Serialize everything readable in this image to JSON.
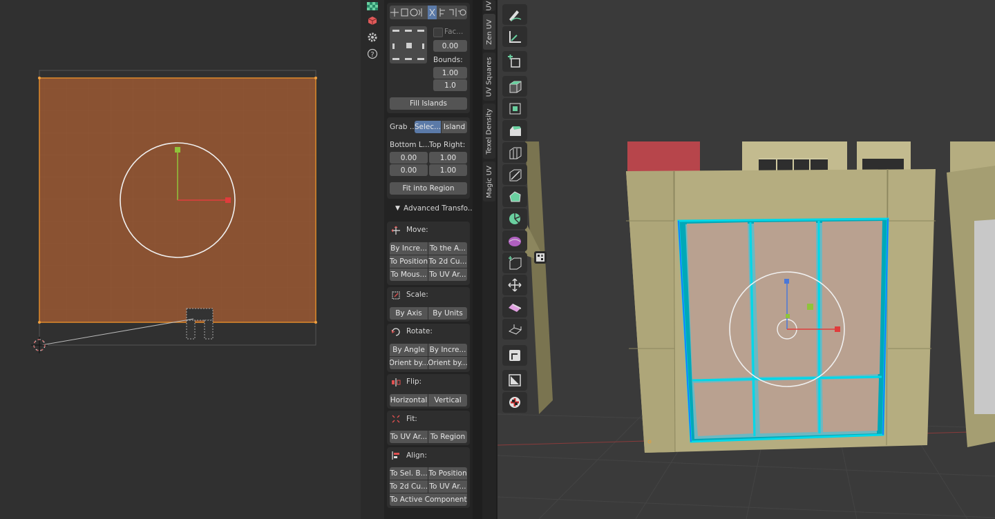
{
  "tabs": [
    {
      "label": "UV"
    },
    {
      "label": "Zen UV"
    },
    {
      "label": "UV Squares"
    },
    {
      "label": "Texel Density"
    },
    {
      "label": "Magic UV"
    }
  ],
  "fill": {
    "face_checkbox_label": "Fac...",
    "offset_value": "0.00",
    "bounds_label": "Bounds:",
    "bounds_x": "1.00",
    "bounds_y": "1.0",
    "fill_islands_button": "Fill Islands"
  },
  "region": {
    "grab_label": "Grab ...",
    "selected_button": "Selec...",
    "island_button": "Island",
    "bottom_left_label": "Bottom L...",
    "top_right_label": "Top Right:",
    "bl_x": "0.00",
    "bl_y": "0.00",
    "tr_x": "1.00",
    "tr_y": "1.00",
    "fit_button": "Fit into Region"
  },
  "advanced": {
    "header": "Advanced Transfo...",
    "move_label": "Move:",
    "move_buttons": [
      "By Incre...",
      "To the A...",
      "To Position",
      "To 2d Cu...",
      "To Mous...",
      "To UV Ar..."
    ],
    "scale_label": "Scale:",
    "scale_buttons": [
      "By Axis",
      "By Units"
    ],
    "rotate_label": "Rotate:",
    "rotate_buttons": [
      "By Angle",
      "By Incre...",
      "Orient by...",
      "Orient by..."
    ],
    "flip_label": "Flip:",
    "flip_buttons": [
      "Horizontal",
      "Vertical"
    ],
    "fit_label": "Fit:",
    "fit_buttons": [
      "To UV Ar...",
      "To Region"
    ],
    "align_label": "Align:",
    "align_buttons": [
      "To Sel. B...",
      "To Position",
      "To 2d Cu...",
      "To UV Ar...",
      "To Active Component"
    ]
  },
  "colors": {
    "uv_fill": "#8a5232",
    "selection_outline": "#e08a2a",
    "highlight_cyan": "#00c8d8",
    "active_tab": "#5b7aa8",
    "wall": "#b5ad80",
    "door_panel": "#b9a190",
    "red_block": "#b7454b"
  },
  "tools": [
    "draw-icon",
    "measure-icon",
    "add-cube-icon",
    "extrude-icon",
    "inset-icon",
    "bevel-icon",
    "loop-cut-icon",
    "knife-icon",
    "poly-build-icon",
    "spin-icon",
    "smooth-icon",
    "edge-slide-icon",
    "shrink-icon",
    "shear-icon",
    "rip-icon",
    "transform-icon",
    "cursor-icon",
    "checker-icon"
  ]
}
